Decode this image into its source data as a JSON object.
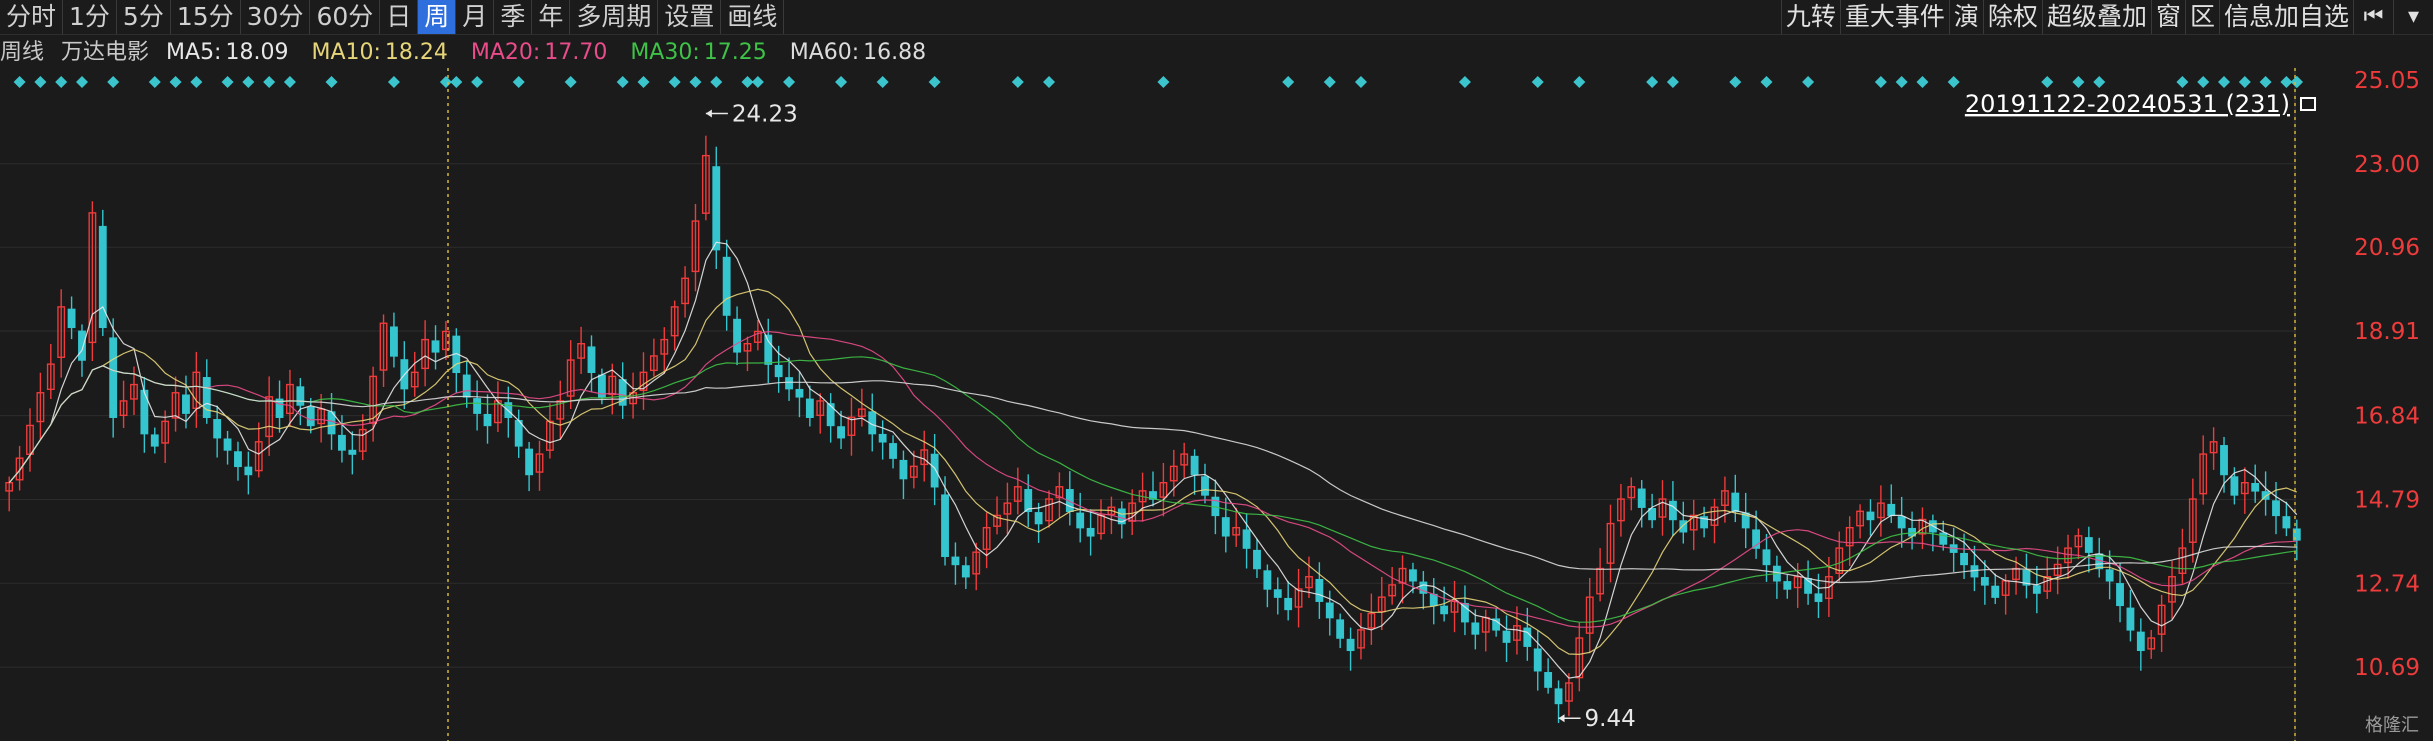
{
  "toolbar": {
    "periods": [
      "分时",
      "1分",
      "5分",
      "15分",
      "30分",
      "60分",
      "日",
      "周",
      "月",
      "季",
      "年",
      "多周期",
      "设置",
      "画线"
    ],
    "active_period": "周",
    "tools": [
      "九转",
      "重大事件",
      "演",
      "除权",
      "超级叠加",
      "窗",
      "区",
      "信息加自选"
    ],
    "tool_icons": [
      "skip-start-icon",
      "dropdown-icon"
    ]
  },
  "legend": {
    "period_label": "周线",
    "stock_name": "万达电影",
    "ma5": {
      "label": "MA5:",
      "value": "18.09",
      "color": "#e8e8e8"
    },
    "ma10": {
      "label": "MA10:",
      "value": "18.24",
      "color": "#e7d57a"
    },
    "ma20": {
      "label": "MA20:",
      "value": "17.70",
      "color": "#e94c8a"
    },
    "ma30": {
      "label": "MA30:",
      "value": "17.25",
      "color": "#3ec247"
    },
    "ma60": {
      "label": "MA60:",
      "value": "16.88",
      "color": "#dcdcdc"
    }
  },
  "range_label": "20191122-20240531 (231)",
  "watermark": "格隆汇",
  "colors": {
    "up": "#ee3b3b",
    "down": "#34c5cf",
    "grid": "#2c2c2c",
    "marker": "#3cc4cc",
    "boundary": "#d8b53a",
    "axis_text": "#ee3b3b"
  },
  "chart_data": {
    "type": "candlestick",
    "y_ticks": [
      25.05,
      23.0,
      20.96,
      18.91,
      16.84,
      14.79,
      12.74,
      10.69
    ],
    "ylim": [
      9.2,
      25.05
    ],
    "grid": true,
    "annotations": [
      {
        "label": "24.23",
        "value": 24.23,
        "kind": "high"
      },
      {
        "label": "9.44",
        "value": 9.44,
        "kind": "low"
      }
    ],
    "series": [
      {
        "name": "MA5",
        "color": "#e8e8e8"
      },
      {
        "name": "MA10",
        "color": "#e7d57a"
      },
      {
        "name": "MA20",
        "color": "#e94c8a"
      },
      {
        "name": "MA30",
        "color": "#3ec247"
      },
      {
        "name": "MA60",
        "color": "#dcdcdc"
      }
    ],
    "closes": [
      15.2,
      15.8,
      16.6,
      17.4,
      18.1,
      19.5,
      19.0,
      18.2,
      21.8,
      19.0,
      16.8,
      17.2,
      17.6,
      16.4,
      16.1,
      16.7,
      17.4,
      16.9,
      17.9,
      16.8,
      16.3,
      16.0,
      15.6,
      15.4,
      16.2,
      17.3,
      16.8,
      17.6,
      17.1,
      16.6,
      17.0,
      16.4,
      16.0,
      15.9,
      16.5,
      17.8,
      19.1,
      18.3,
      17.5,
      17.9,
      18.7,
      18.4,
      18.9,
      17.9,
      17.3,
      16.9,
      16.6,
      17.2,
      16.8,
      16.1,
      15.4,
      15.9,
      16.7,
      17.2,
      18.2,
      18.6,
      17.9,
      17.3,
      17.8,
      17.1,
      17.4,
      17.9,
      18.3,
      18.7,
      19.5,
      20.2,
      21.6,
      23.2,
      20.9,
      19.3,
      18.4,
      18.6,
      18.9,
      18.1,
      17.8,
      17.5,
      17.3,
      16.8,
      17.2,
      16.6,
      16.3,
      16.8,
      17.0,
      16.4,
      16.2,
      15.8,
      15.3,
      15.6,
      16.0,
      15.1,
      13.4,
      13.2,
      12.9,
      13.5,
      14.1,
      14.4,
      14.7,
      15.1,
      14.5,
      14.2,
      14.8,
      15.1,
      14.5,
      14.1,
      13.9,
      14.4,
      14.6,
      14.2,
      14.7,
      15.0,
      14.8,
      15.2,
      15.6,
      15.9,
      15.4,
      14.9,
      14.4,
      13.9,
      14.1,
      13.6,
      13.1,
      12.6,
      12.4,
      12.1,
      12.6,
      12.9,
      12.3,
      11.9,
      11.4,
      11.1,
      11.6,
      12.0,
      12.4,
      12.7,
      13.1,
      12.8,
      12.5,
      12.2,
      12.0,
      12.3,
      11.8,
      11.5,
      11.9,
      11.6,
      11.3,
      11.7,
      11.2,
      10.6,
      10.2,
      9.8,
      10.3,
      11.4,
      12.4,
      13.1,
      14.2,
      14.8,
      15.1,
      14.6,
      14.3,
      14.8,
      14.3,
      14.0,
      14.4,
      14.1,
      14.6,
      15.0,
      14.5,
      14.1,
      13.6,
      13.2,
      12.8,
      12.6,
      12.9,
      12.5,
      12.3,
      12.9,
      13.6,
      14.1,
      14.5,
      14.3,
      14.7,
      14.4,
      14.1,
      13.9,
      14.3,
      14.0,
      13.7,
      13.5,
      13.2,
      12.9,
      12.7,
      12.4,
      12.8,
      13.1,
      12.7,
      12.5,
      12.9,
      13.2,
      13.6,
      13.9,
      13.5,
      13.1,
      12.8,
      12.2,
      11.6,
      11.1,
      11.4,
      12.2,
      12.9,
      13.6,
      14.8,
      15.9,
      16.2,
      15.4,
      14.9,
      15.2,
      15.0,
      14.8,
      14.4,
      14.1,
      13.8
    ]
  }
}
